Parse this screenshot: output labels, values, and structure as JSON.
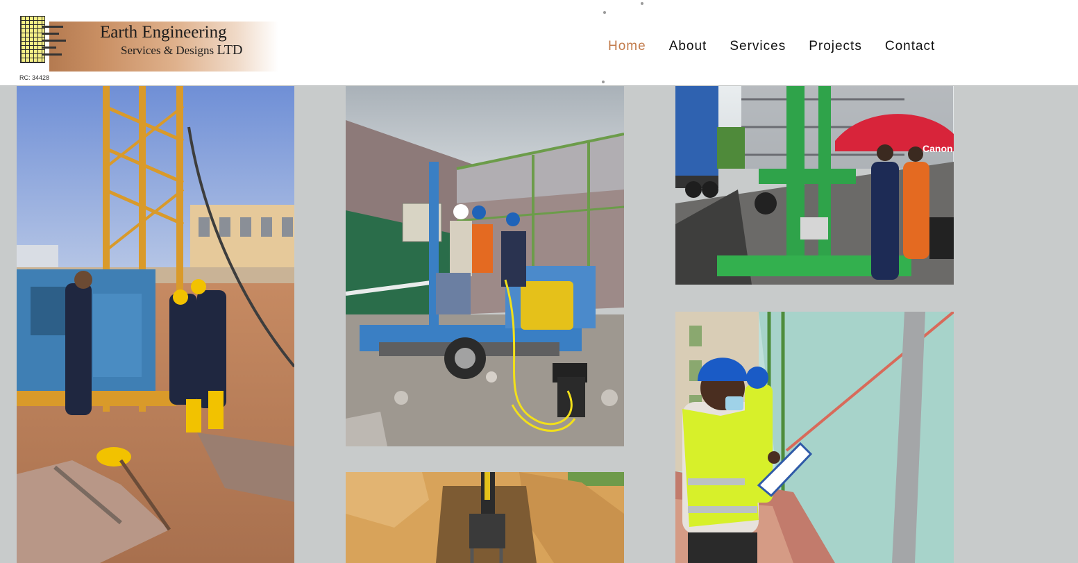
{
  "logo": {
    "line1": "Earth Engineering",
    "line2": "Services & Designs",
    "line2_suffix": "LTD",
    "rc": "RC: 34428"
  },
  "nav": {
    "items": [
      {
        "label": "Home",
        "active": true
      },
      {
        "label": "About",
        "active": false
      },
      {
        "label": "Services",
        "active": false
      },
      {
        "label": "Projects",
        "active": false
      },
      {
        "label": "Contact",
        "active": false
      }
    ]
  },
  "gallery": {
    "photos": [
      {
        "subject": "drilling-rig-workers"
      },
      {
        "subject": "trailer-drill-crew"
      },
      {
        "subject": "excavator-trench"
      },
      {
        "subject": "green-drill-rig"
      },
      {
        "subject": "engineer-clipboard"
      }
    ],
    "photo3_text": "Canon"
  },
  "colors": {
    "accent": "#c27b4b",
    "background": "#c8cbcb",
    "header": "#ffffff"
  }
}
